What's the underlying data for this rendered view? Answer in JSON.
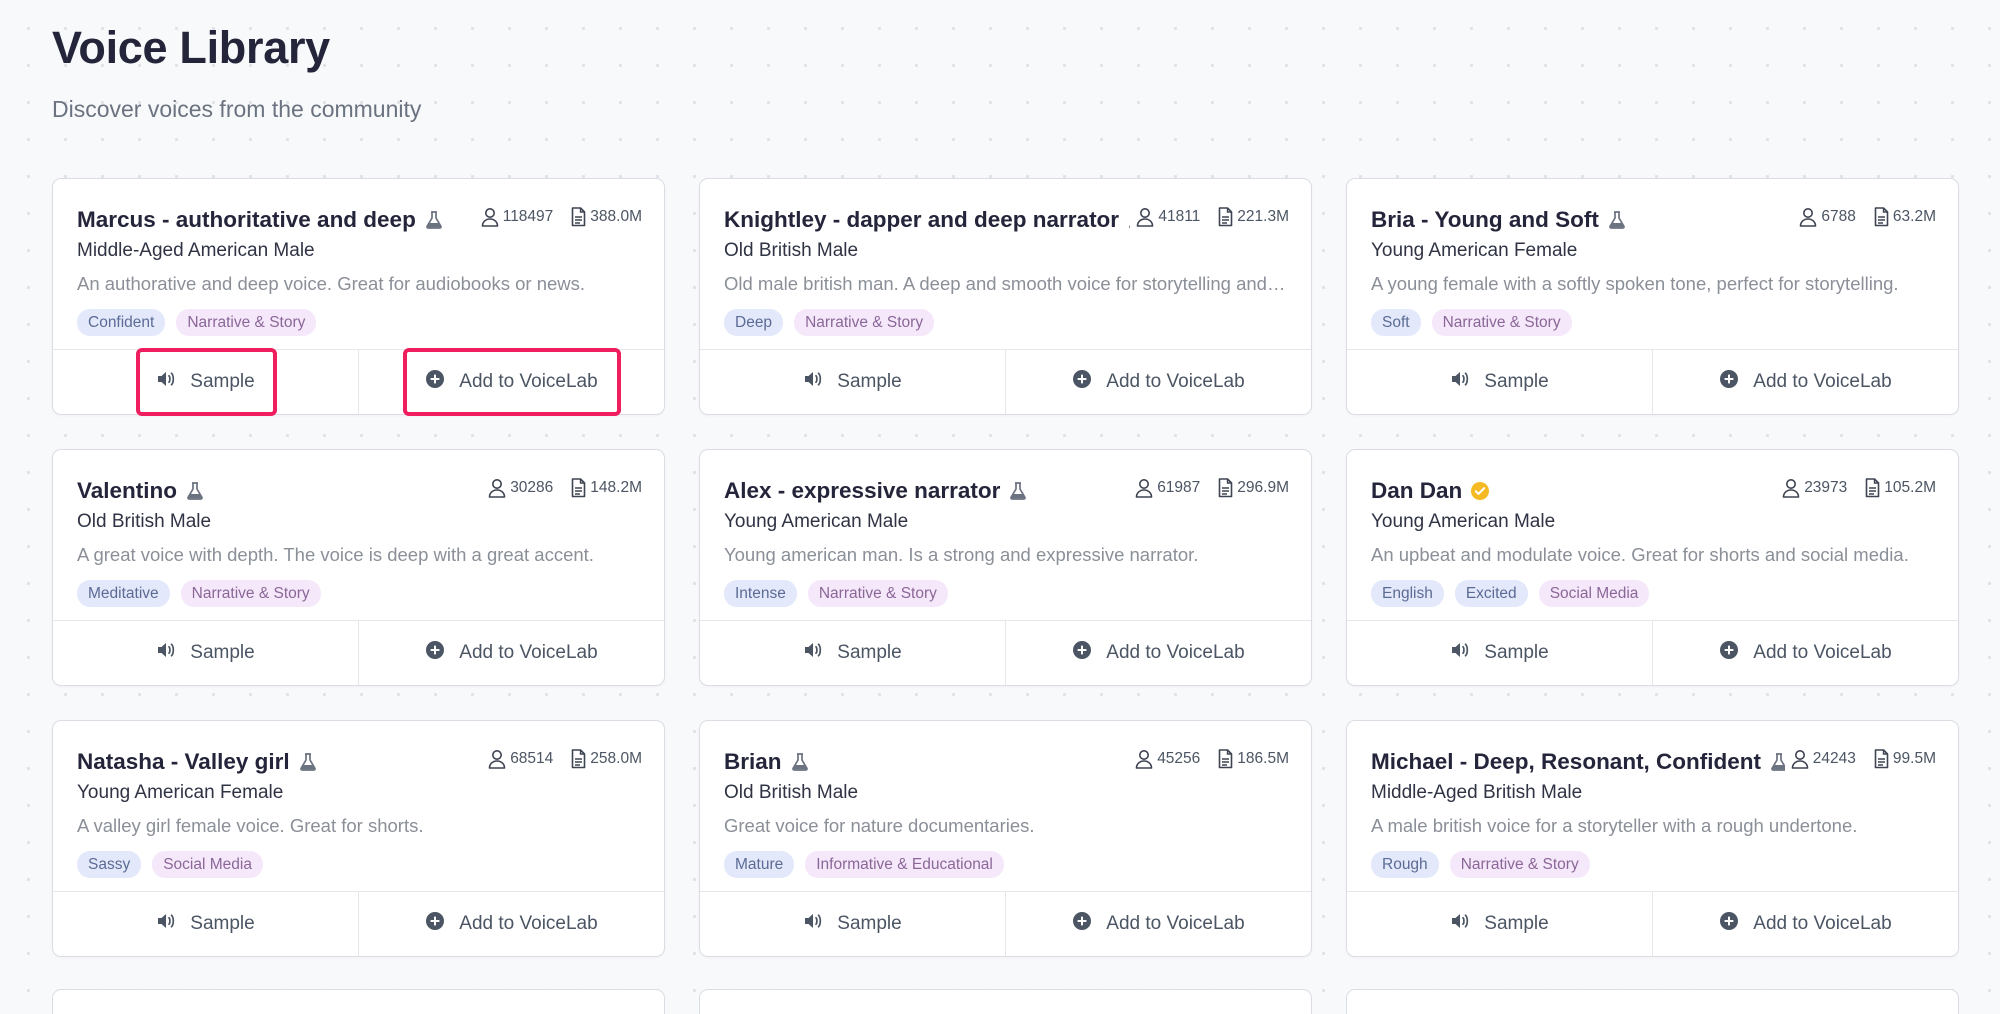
{
  "page": {
    "title": "Voice Library",
    "subtitle": "Discover voices from the community"
  },
  "actions": {
    "sample_label": "Sample",
    "add_label": "Add to VoiceLab"
  },
  "colors": {
    "highlight": "#ef1f5f",
    "tag_blue_bg": "#e3e9fb",
    "tag_purple_bg": "#f5e8fb",
    "verified": "#f5b924"
  },
  "cards": [
    {
      "name": "Marcus - authoritative and deep",
      "badge": "flask-icon",
      "users": "118497",
      "chars": "388.0M",
      "subtitle": "Middle-Aged American Male",
      "description": "An authorative and deep voice. Great for audiobooks or news.",
      "tags": [
        {
          "label": "Confident",
          "color": "blue"
        },
        {
          "label": "Narrative & Story",
          "color": "purple"
        }
      ],
      "highlighted": true
    },
    {
      "name": "Knightley - dapper and deep narrator",
      "badge": "flask-icon",
      "users": "41811",
      "chars": "221.3M",
      "subtitle": "Old British Male",
      "description": "Old male british man. A deep and smooth voice for storytelling and podcasts.",
      "tags": [
        {
          "label": "Deep",
          "color": "blue"
        },
        {
          "label": "Narrative & Story",
          "color": "purple"
        }
      ]
    },
    {
      "name": "Bria - Young and Soft",
      "badge": "flask-icon",
      "users": "6788",
      "chars": "63.2M",
      "subtitle": "Young American Female",
      "description": "A young female with a softly spoken tone, perfect for storytelling.",
      "tags": [
        {
          "label": "Soft",
          "color": "blue"
        },
        {
          "label": "Narrative & Story",
          "color": "purple"
        }
      ]
    },
    {
      "name": "Valentino",
      "badge": "flask-icon",
      "users": "30286",
      "chars": "148.2M",
      "subtitle": "Old British Male",
      "description": "A great voice with depth. The voice is deep with a great accent.",
      "tags": [
        {
          "label": "Meditative",
          "color": "blue"
        },
        {
          "label": "Narrative & Story",
          "color": "purple"
        }
      ]
    },
    {
      "name": "Alex - expressive narrator",
      "badge": "flask-icon",
      "users": "61987",
      "chars": "296.9M",
      "subtitle": "Young American Male",
      "description": "Young american man. Is a strong and expressive narrator.",
      "tags": [
        {
          "label": "Intense",
          "color": "blue"
        },
        {
          "label": "Narrative & Story",
          "color": "purple"
        }
      ]
    },
    {
      "name": "Dan Dan",
      "badge": "verified-icon",
      "users": "23973",
      "chars": "105.2M",
      "subtitle": "Young American Male",
      "description": "An upbeat and modulate voice. Great for shorts and social media.",
      "tags": [
        {
          "label": "English",
          "color": "blue"
        },
        {
          "label": "Excited",
          "color": "blue"
        },
        {
          "label": "Social Media",
          "color": "purple"
        }
      ]
    },
    {
      "name": "Natasha - Valley girl",
      "badge": "flask-icon",
      "users": "68514",
      "chars": "258.0M",
      "subtitle": "Young American Female",
      "description": "A valley girl female voice. Great for shorts.",
      "tags": [
        {
          "label": "Sassy",
          "color": "blue"
        },
        {
          "label": "Social Media",
          "color": "purple"
        }
      ]
    },
    {
      "name": "Brian",
      "badge": "flask-icon",
      "users": "45256",
      "chars": "186.5M",
      "subtitle": "Old British Male",
      "description": "Great voice for nature documentaries.",
      "tags": [
        {
          "label": "Mature",
          "color": "blue"
        },
        {
          "label": "Informative & Educational",
          "color": "purple"
        }
      ]
    },
    {
      "name": "Michael - Deep, Resonant, Confident",
      "badge": "flask-icon",
      "users": "24243",
      "chars": "99.5M",
      "subtitle": "Middle-Aged British Male",
      "description": "A male british voice for a storyteller with a rough undertone.",
      "tags": [
        {
          "label": "Rough",
          "color": "blue"
        },
        {
          "label": "Narrative & Story",
          "color": "purple"
        }
      ]
    }
  ]
}
